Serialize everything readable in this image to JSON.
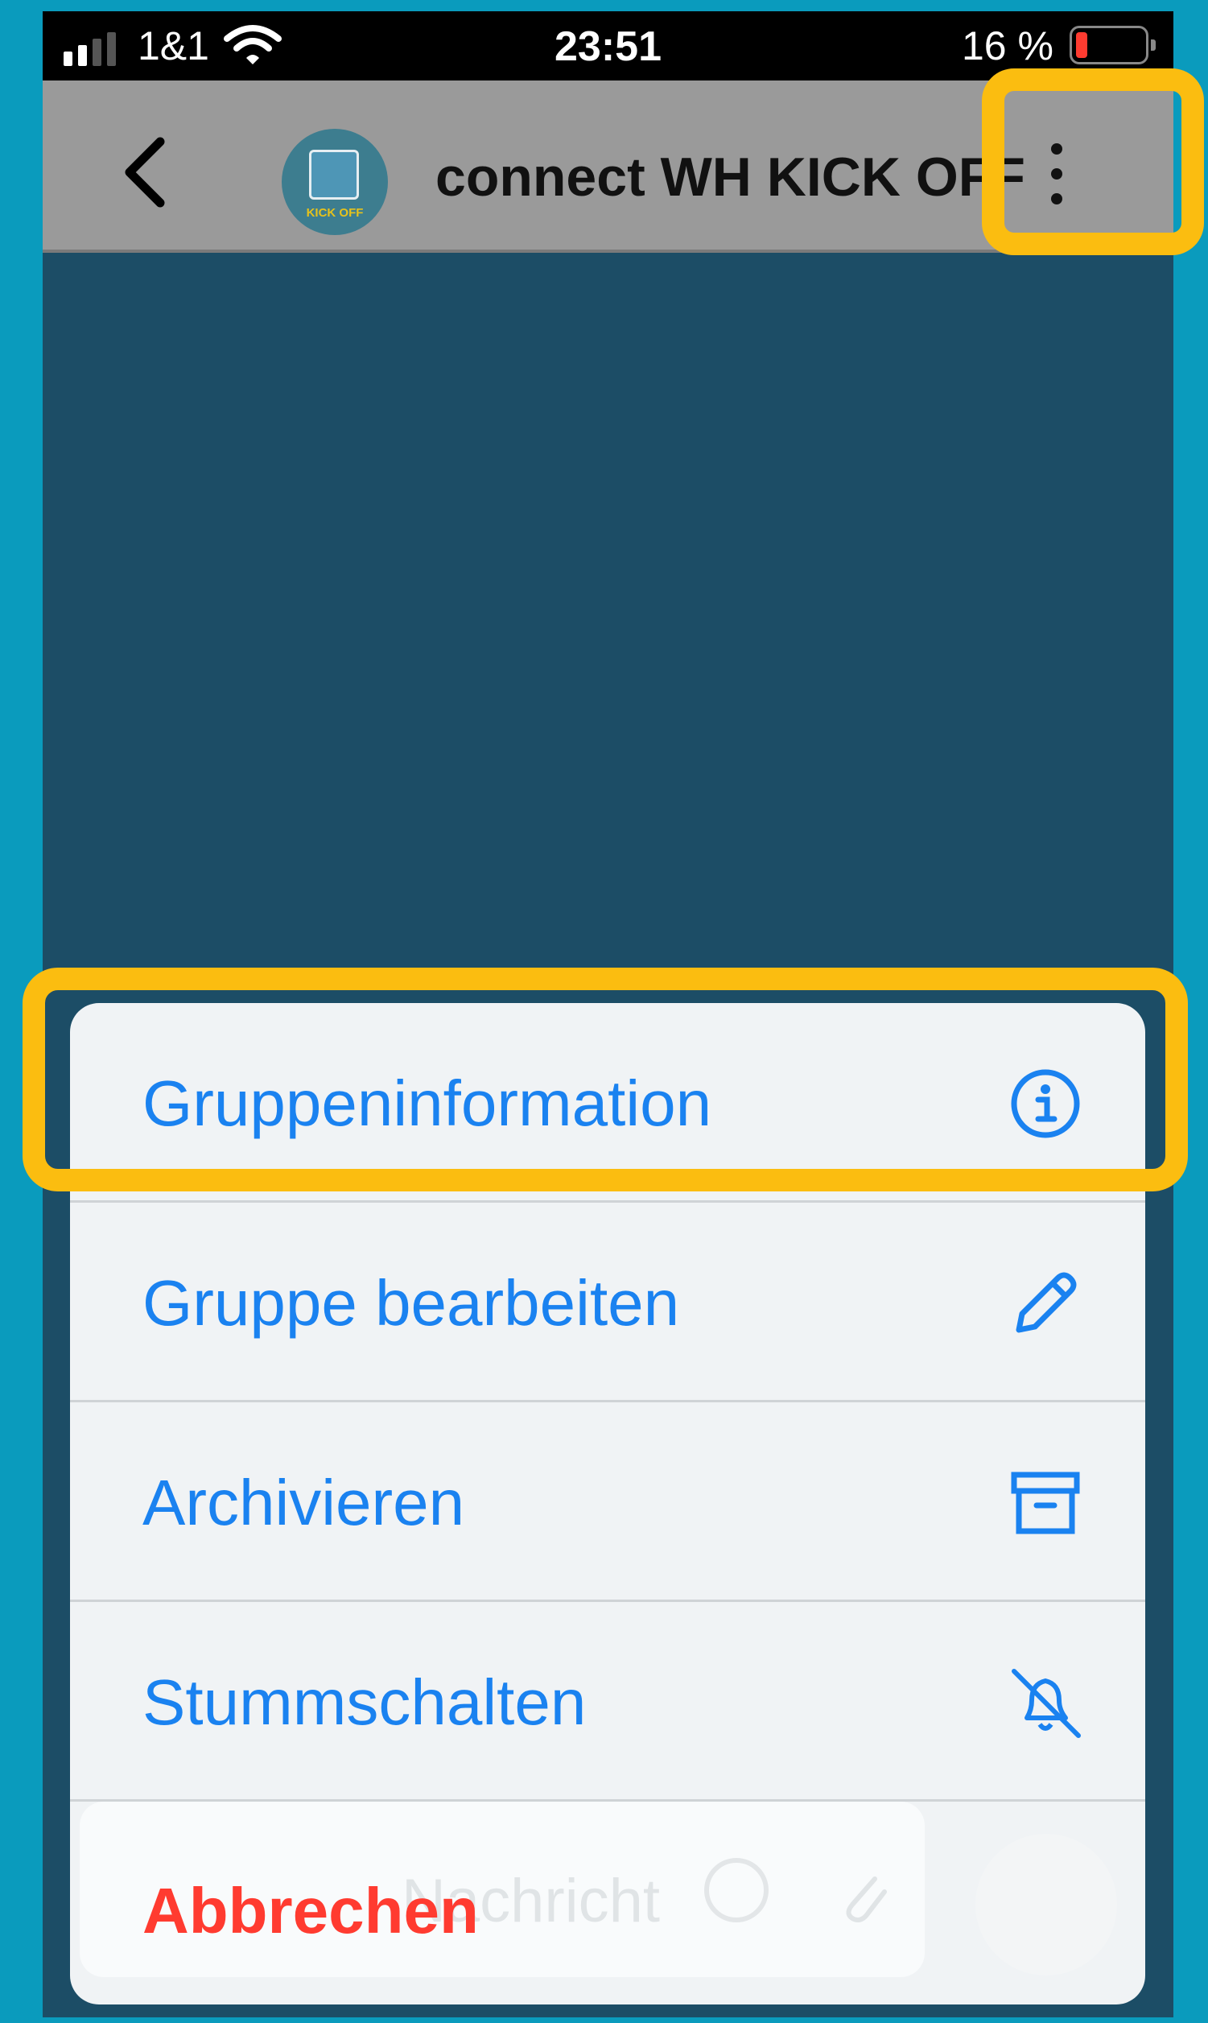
{
  "status_bar": {
    "carrier": "1&1",
    "time": "23:51",
    "battery_percent": "16 %",
    "battery_color": "#ff3b30"
  },
  "header": {
    "title": "connect WH KICK OFF",
    "avatar_label": "KICK OFF",
    "back_icon": "chevron-left-icon",
    "menu_icon": "more-vertical-icon"
  },
  "action_sheet": {
    "items": [
      {
        "label": "Gruppeninformation",
        "icon": "info-icon"
      },
      {
        "label": "Gruppe bearbeiten",
        "icon": "pencil-icon"
      },
      {
        "label": "Archivieren",
        "icon": "archive-icon"
      },
      {
        "label": "Stummschalten",
        "icon": "bell-off-icon"
      }
    ],
    "cancel_label": "Abbrechen"
  },
  "composer": {
    "placeholder": "Nachricht"
  },
  "colors": {
    "highlight": "#fbbd10",
    "accent": "#1a82f0",
    "danger": "#ff3b30",
    "chat_background": "#1c4d66",
    "outer_background": "#0a9bbd"
  }
}
